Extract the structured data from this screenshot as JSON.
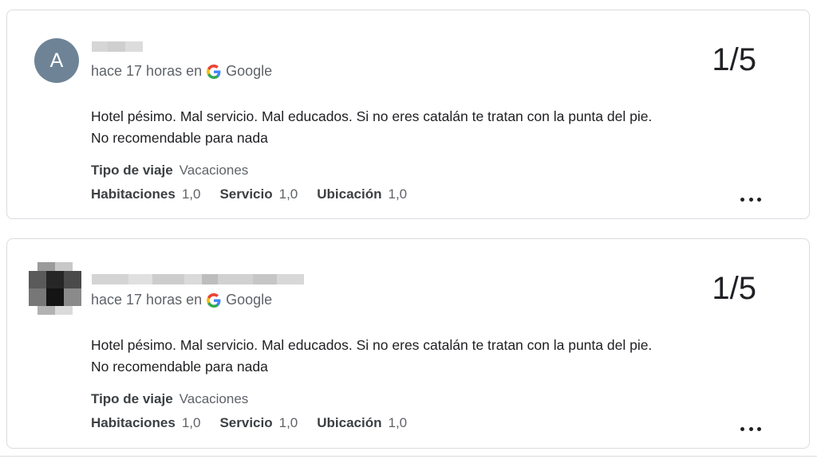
{
  "reviews": [
    {
      "avatar_letter": "A",
      "meta_prefix": "hace 17 horas en",
      "source": "Google",
      "rating": "1/5",
      "text_line1": "Hotel pésimo. Mal servicio. Mal educados. Si no eres catalán te tratan con la punta del pie.",
      "text_line2": "No recomendable para nada",
      "trip_type_label": "Tipo de viaje",
      "trip_type_value": "Vacaciones",
      "rooms_label": "Habitaciones",
      "rooms_value": "1,0",
      "service_label": "Servicio",
      "service_value": "1,0",
      "location_label": "Ubicación",
      "location_value": "1,0"
    },
    {
      "meta_prefix": "hace 17 horas en",
      "source": "Google",
      "rating": "1/5",
      "text_line1": "Hotel pésimo. Mal servicio. Mal educados. Si no eres catalán te tratan con la punta del pie.",
      "text_line2": "No recomendable para nada",
      "trip_type_label": "Tipo de viaje",
      "trip_type_value": "Vacaciones",
      "rooms_label": "Habitaciones",
      "rooms_value": "1,0",
      "service_label": "Servicio",
      "service_value": "1,0",
      "location_label": "Ubicación",
      "location_value": "1,0"
    }
  ],
  "icons": {
    "source_logo": "google-g-icon",
    "more": "more-options-icon"
  },
  "colors": {
    "avatar_bg": "#6e8496",
    "border": "#dadce0",
    "muted_text": "#5f6368"
  }
}
